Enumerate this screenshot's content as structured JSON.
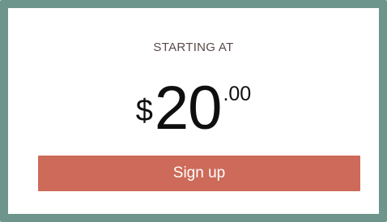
{
  "pricing": {
    "starting_label": "STARTING AT",
    "currency_symbol": "$",
    "price_whole": "20",
    "price_cents": ".00"
  },
  "signup": {
    "button_label": "Sign up"
  },
  "colors": {
    "card_border": "#6e958b",
    "button_background": "#cd6a59",
    "button_text": "#ffffff",
    "label_text": "#5a4a48",
    "price_text": "#0f0f0f"
  }
}
